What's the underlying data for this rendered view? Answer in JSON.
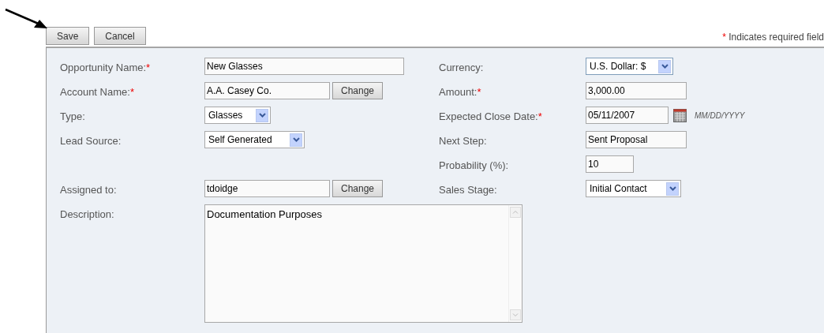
{
  "toolbar": {
    "buttons": [
      "Save",
      "Cancel"
    ],
    "required_note": "Indicates required field",
    "required_mark": "*"
  },
  "rows": [
    {
      "left": {
        "kind": "text",
        "label": "Opportunity Name:",
        "required": true,
        "value": "New Glasses"
      },
      "right": {
        "kind": "select",
        "label": "Currency:",
        "required": false,
        "value": "U.S. Dollar: $",
        "focused": true
      }
    },
    {
      "left": {
        "kind": "lookup",
        "label": "Account Name:",
        "required": true,
        "value": "A.A. Casey Co.",
        "button": "Change"
      },
      "right": {
        "kind": "text",
        "label": "Amount:",
        "required": true,
        "value": "3,000.00"
      }
    },
    {
      "left": {
        "kind": "select",
        "label": "Type:",
        "required": false,
        "value": "Glasses",
        "focused": false
      },
      "right": {
        "kind": "date",
        "label": "Expected Close Date:",
        "required": true,
        "value": "05/11/2007",
        "hint": "MM/DD/YYYY"
      }
    },
    {
      "left": {
        "kind": "select",
        "label": "Lead Source:",
        "required": false,
        "value": "Self Generated",
        "focused": false
      },
      "right": {
        "kind": "text",
        "label": "Next Step:",
        "required": false,
        "value": "Sent Proposal"
      }
    },
    {
      "right": {
        "kind": "text",
        "label": "Probability (%):",
        "required": false,
        "value": "10"
      }
    },
    {
      "left": {
        "kind": "lookup",
        "label": "Assigned to:",
        "required": false,
        "value": "tdoidge",
        "button": "Change"
      },
      "right": {
        "kind": "select",
        "label": "Sales Stage:",
        "required": false,
        "value": "Initial Contact",
        "focused": false
      }
    },
    {
      "left": {
        "kind": "textarea",
        "label": "Description:",
        "required": false,
        "value": "Documentation Purposes"
      }
    }
  ]
}
